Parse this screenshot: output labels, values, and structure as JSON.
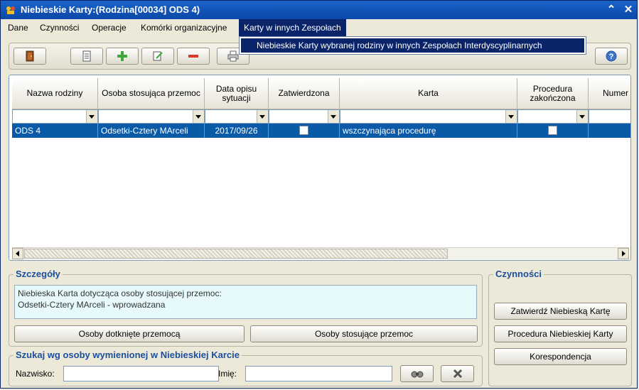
{
  "window": {
    "title": "Niebieskie Karty:(Rodzina[00034] ODS 4)",
    "minimize_glyph": "⌃",
    "close_glyph": "✕"
  },
  "menu": {
    "items": [
      "Dane",
      "Czynności",
      "Operacje",
      "Komórki organizacyjne",
      "Karty w innych Zespołach"
    ],
    "open_dropdown": {
      "item": "Niebieskie Karty wybranej rodziny w innych Zespołach Interdyscyplinarnych"
    }
  },
  "toolbar": {
    "buttons": [
      "exit-door-icon",
      "open-document-icon",
      "add-plus-icon",
      "edit-document-icon",
      "delete-minus-icon",
      "print-icon",
      "help-icon"
    ]
  },
  "grid": {
    "columns": [
      "Nazwa rodziny",
      "Osoba stosująca przemoc",
      "Data opisu sytuacji",
      "Zatwierdzona",
      "Karta",
      "Procedura zakończona",
      "Numer"
    ],
    "rows": [
      {
        "nazwa": "ODS 4",
        "osoba": "Odsetki-Cztery MArceli",
        "data": "2017/09/26",
        "zatwierdzona": false,
        "karta": "wszczynająca procedurę",
        "procedura": false
      }
    ]
  },
  "details": {
    "title": "Szczegóły",
    "text_line1": "Niebieska Karta dotycząca osoby stosującej przemoc:",
    "text_line2": "Odsetki-Cztery MArceli - wprowadzana",
    "btn_affected": "Osoby dotknięte przemocą",
    "btn_perpetrators": "Osoby stosujące przemoc"
  },
  "search": {
    "title": "Szukaj wg osoby wymienionej w Niebieskiej Karcie",
    "surname_label": "Nazwisko:",
    "surname_value": "",
    "name_label": "Imię:",
    "name_value": ""
  },
  "actions": {
    "title": "Czynności",
    "approve": "Zatwierdź Niebieską Kartę",
    "procedure": "Procedura Niebieskiej Karty",
    "correspondence": "Korespondencja"
  },
  "colors": {
    "title_bar": "#0b47a8",
    "selection": "#0a5aa8",
    "menu_active": "#0a246a",
    "group_title": "#1b4fa0"
  }
}
